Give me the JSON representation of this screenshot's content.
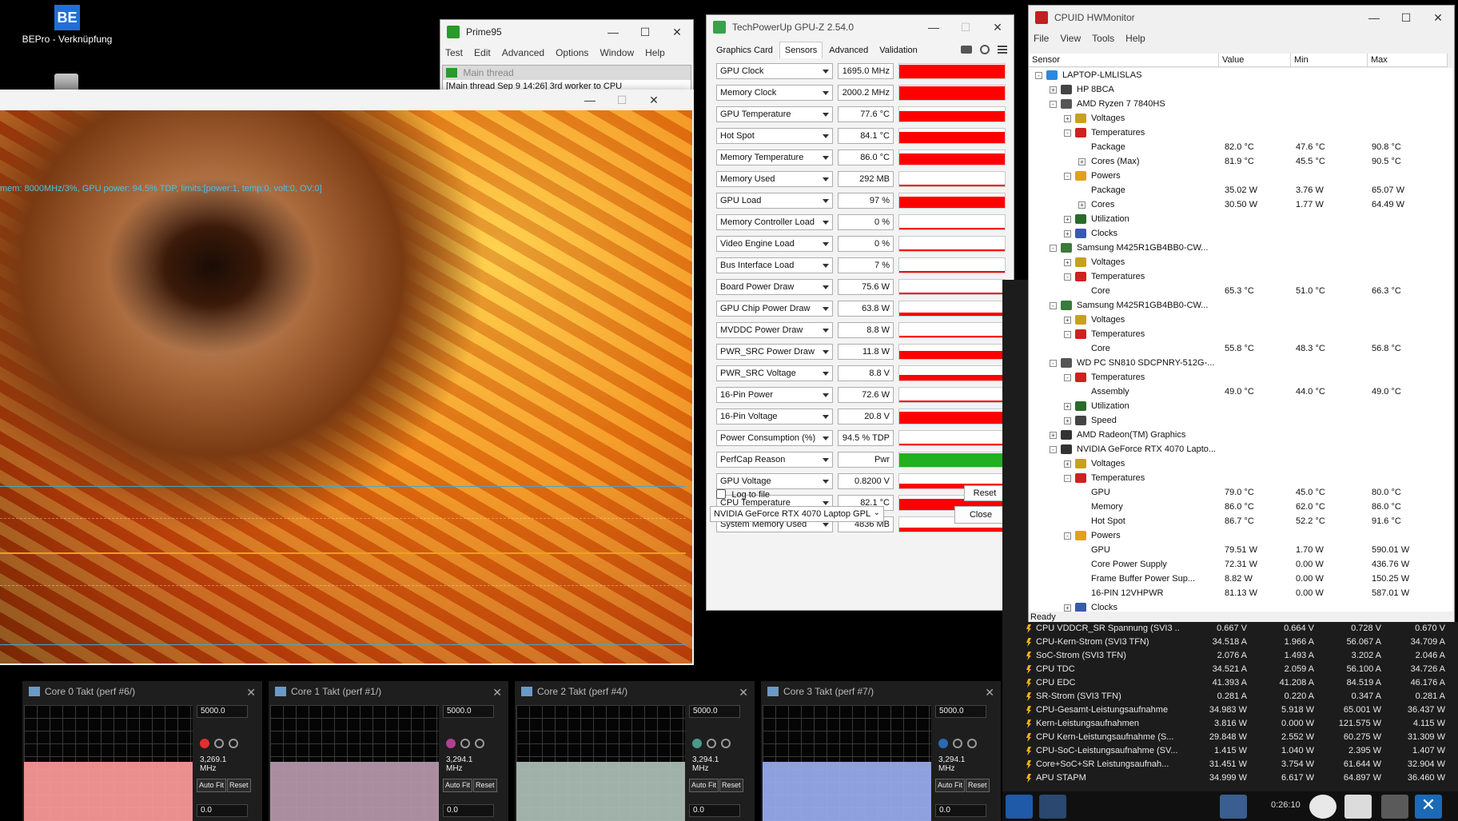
{
  "desktop": {
    "shortcut_label": "BEPro - Verknüpfung",
    "logo_text": "BE"
  },
  "prime95": {
    "title": "Prime95",
    "menu": [
      "Test",
      "Edit",
      "Advanced",
      "Options",
      "Window",
      "Help"
    ],
    "subwindow_title": "Main thread",
    "subwindow_text": "[Main thread Sep 9 14:26] 3rd worker to CPU"
  },
  "furmark": {
    "info_text": "mem: 8000MHz/3%, GPU power: 94.5% TDP, limits:[power:1, temp:0, volt:0, OV:0]"
  },
  "gpuz": {
    "title": "TechPowerUp GPU-Z 2.54.0",
    "tabs": [
      "Graphics Card",
      "Sensors",
      "Advanced",
      "Validation"
    ],
    "active_tab": "Sensors",
    "sensors": [
      {
        "name": "GPU Clock",
        "value": "1695.0 MHz",
        "level": 0.95,
        "color": "#ff0000"
      },
      {
        "name": "Memory Clock",
        "value": "2000.2 MHz",
        "level": 0.95,
        "color": "#ff0000"
      },
      {
        "name": "GPU Temperature",
        "value": "77.6 °C",
        "level": 0.7,
        "color": "#ff0000"
      },
      {
        "name": "Hot Spot",
        "value": "84.1 °C",
        "level": 0.75,
        "color": "#ff0000"
      },
      {
        "name": "Memory Temperature",
        "value": "86.0 °C",
        "level": 0.75,
        "color": "#ff0000"
      },
      {
        "name": "Memory Used",
        "value": "292 MB",
        "level": 0.05,
        "color": "#ff0000"
      },
      {
        "name": "GPU Load",
        "value": "97 %",
        "level": 0.75,
        "color": "#ff0000"
      },
      {
        "name": "Memory Controller Load",
        "value": "0 %",
        "level": 0.0,
        "color": "#ff0000"
      },
      {
        "name": "Video Engine Load",
        "value": "0 %",
        "level": 0.0,
        "color": "#ff0000"
      },
      {
        "name": "Bus Interface Load",
        "value": "7 %",
        "level": 0.07,
        "color": "#ff0000"
      },
      {
        "name": "Board Power Draw",
        "value": "75.6 W",
        "level": 0.1,
        "color": "#ff0000"
      },
      {
        "name": "GPU Chip Power Draw",
        "value": "63.8 W",
        "level": 0.2,
        "color": "#ff0000"
      },
      {
        "name": "MVDDC Power Draw",
        "value": "8.8 W",
        "level": 0.1,
        "color": "#ff0000"
      },
      {
        "name": "PWR_SRC Power Draw",
        "value": "11.8 W",
        "level": 0.55,
        "color": "#ff0000"
      },
      {
        "name": "PWR_SRC Voltage",
        "value": "8.8 V",
        "level": 0.4,
        "color": "#ff0000"
      },
      {
        "name": "16-Pin Power",
        "value": "72.6 W",
        "level": 0.1,
        "color": "#ff0000"
      },
      {
        "name": "16-Pin Voltage",
        "value": "20.8 V",
        "level": 0.85,
        "color": "#ff0000"
      },
      {
        "name": "Power Consumption (%)",
        "value": "94.5 % TDP",
        "level": 0.1,
        "color": "#ff0000"
      },
      {
        "name": "PerfCap Reason",
        "value": "Pwr",
        "level": 0.95,
        "color": "#20b020"
      },
      {
        "name": "GPU Voltage",
        "value": "0.8200 V",
        "level": 0.35,
        "color": "#ff0000"
      },
      {
        "name": "CPU Temperature",
        "value": "82.1 °C",
        "level": 0.75,
        "color": "#ff0000"
      },
      {
        "name": "System Memory Used",
        "value": "4836 MB",
        "level": 0.3,
        "color": "#ff0000"
      }
    ],
    "log_to_file": "Log to file",
    "reset": "Reset",
    "device": "NVIDIA GeForce RTX 4070 Laptop GPL",
    "close": "Close"
  },
  "hwmonitor": {
    "title": "CPUID HWMonitor",
    "menu": [
      "File",
      "View",
      "Tools",
      "Help"
    ],
    "columns": [
      "Sensor",
      "Value",
      "Min",
      "Max"
    ],
    "status": "Ready",
    "rows": [
      {
        "label": "LAPTOP-LMLISLAS",
        "indent": 0,
        "exp": "-",
        "icon": "computer-icon"
      },
      {
        "label": "HP 8BCA",
        "indent": 1,
        "exp": "+",
        "icon": "motherboard-icon"
      },
      {
        "label": "AMD Ryzen 7 7840HS",
        "indent": 1,
        "exp": "-",
        "icon": "cpu-icon"
      },
      {
        "label": "Voltages",
        "indent": 2,
        "exp": "+",
        "icon": "voltage-icon"
      },
      {
        "label": "Temperatures",
        "indent": 2,
        "exp": "-",
        "icon": "thermometer-icon"
      },
      {
        "label": "Package",
        "indent": 3,
        "exp": "",
        "icon": "",
        "v": "82.0 °C",
        "min": "47.6 °C",
        "max": "90.8 °C"
      },
      {
        "label": "Cores (Max)",
        "indent": 3,
        "exp": "+",
        "icon": "",
        "v": "81.9 °C",
        "min": "45.5 °C",
        "max": "90.5 °C"
      },
      {
        "label": "Powers",
        "indent": 2,
        "exp": "-",
        "icon": "power-icon"
      },
      {
        "label": "Package",
        "indent": 3,
        "exp": "",
        "icon": "",
        "v": "35.02 W",
        "min": "3.76 W",
        "max": "65.07 W"
      },
      {
        "label": "Cores",
        "indent": 3,
        "exp": "+",
        "icon": "",
        "v": "30.50 W",
        "min": "1.77 W",
        "max": "64.49 W"
      },
      {
        "label": "Utilization",
        "indent": 2,
        "exp": "+",
        "icon": "utilization-icon"
      },
      {
        "label": "Clocks",
        "indent": 2,
        "exp": "+",
        "icon": "clocks-icon"
      },
      {
        "label": "Samsung M425R1GB4BB0-CW...",
        "indent": 1,
        "exp": "-",
        "icon": "memory-icon"
      },
      {
        "label": "Voltages",
        "indent": 2,
        "exp": "+",
        "icon": "voltage-icon"
      },
      {
        "label": "Temperatures",
        "indent": 2,
        "exp": "-",
        "icon": "thermometer-icon"
      },
      {
        "label": "Core",
        "indent": 3,
        "exp": "",
        "icon": "",
        "v": "65.3 °C",
        "min": "51.0 °C",
        "max": "66.3 °C"
      },
      {
        "label": "Samsung M425R1GB4BB0-CW...",
        "indent": 1,
        "exp": "-",
        "icon": "memory-icon"
      },
      {
        "label": "Voltages",
        "indent": 2,
        "exp": "+",
        "icon": "voltage-icon"
      },
      {
        "label": "Temperatures",
        "indent": 2,
        "exp": "-",
        "icon": "thermometer-icon"
      },
      {
        "label": "Core",
        "indent": 3,
        "exp": "",
        "icon": "",
        "v": "55.8 °C",
        "min": "48.3 °C",
        "max": "56.8 °C"
      },
      {
        "label": "WD PC SN810 SDCPNRY-512G-...",
        "indent": 1,
        "exp": "-",
        "icon": "drive-icon"
      },
      {
        "label": "Temperatures",
        "indent": 2,
        "exp": "-",
        "icon": "thermometer-icon"
      },
      {
        "label": "Assembly",
        "indent": 3,
        "exp": "",
        "icon": "",
        "v": "49.0 °C",
        "min": "44.0 °C",
        "max": "49.0 °C"
      },
      {
        "label": "Utilization",
        "indent": 2,
        "exp": "+",
        "icon": "utilization-icon"
      },
      {
        "label": "Speed",
        "indent": 2,
        "exp": "+",
        "icon": "speed-icon"
      },
      {
        "label": "AMD Radeon(TM) Graphics",
        "indent": 1,
        "exp": "+",
        "icon": "gpu-icon"
      },
      {
        "label": "NVIDIA GeForce RTX 4070 Lapto...",
        "indent": 1,
        "exp": "-",
        "icon": "gpu-icon"
      },
      {
        "label": "Voltages",
        "indent": 2,
        "exp": "+",
        "icon": "voltage-icon"
      },
      {
        "label": "Temperatures",
        "indent": 2,
        "exp": "-",
        "icon": "thermometer-icon"
      },
      {
        "label": "GPU",
        "indent": 3,
        "exp": "",
        "icon": "",
        "v": "79.0 °C",
        "min": "45.0 °C",
        "max": "80.0 °C"
      },
      {
        "label": "Memory",
        "indent": 3,
        "exp": "",
        "icon": "",
        "v": "86.0 °C",
        "min": "62.0 °C",
        "max": "86.0 °C"
      },
      {
        "label": "Hot Spot",
        "indent": 3,
        "exp": "",
        "icon": "",
        "v": "86.7 °C",
        "min": "52.2 °C",
        "max": "91.6 °C"
      },
      {
        "label": "Powers",
        "indent": 2,
        "exp": "-",
        "icon": "power-icon"
      },
      {
        "label": "GPU",
        "indent": 3,
        "exp": "",
        "icon": "",
        "v": "79.51 W",
        "min": "1.70 W",
        "max": "590.01 W"
      },
      {
        "label": "Core Power Supply",
        "indent": 3,
        "exp": "",
        "icon": "",
        "v": "72.31 W",
        "min": "0.00 W",
        "max": "436.76 W"
      },
      {
        "label": "Frame Buffer Power Sup...",
        "indent": 3,
        "exp": "",
        "icon": "",
        "v": "8.82 W",
        "min": "0.00 W",
        "max": "150.25 W"
      },
      {
        "label": "16-PIN 12VHPWR",
        "indent": 3,
        "exp": "",
        "icon": "",
        "v": "81.13 W",
        "min": "0.00 W",
        "max": "587.01 W"
      },
      {
        "label": "Clocks",
        "indent": 2,
        "exp": "+",
        "icon": "clocks-icon"
      }
    ]
  },
  "hwinfo": {
    "rows": [
      {
        "name": "CPU VDDCR_SR Spannung (SVI3 ...",
        "v": "0.667 V",
        "min": "0.664 V",
        "max": "0.728 V",
        "avg": "0.670 V"
      },
      {
        "name": "CPU-Kern-Strom (SVI3 TFN)",
        "v": "34.518 A",
        "min": "1.966 A",
        "max": "56.067 A",
        "avg": "34.709 A"
      },
      {
        "name": "SoC-Strom (SVI3 TFN)",
        "v": "2.076 A",
        "min": "1.493 A",
        "max": "3.202 A",
        "avg": "2.046 A"
      },
      {
        "name": "CPU TDC",
        "v": "34.521 A",
        "min": "2.059 A",
        "max": "56.100 A",
        "avg": "34.726 A"
      },
      {
        "name": "CPU EDC",
        "v": "41.393 A",
        "min": "41.208 A",
        "max": "84.519 A",
        "avg": "46.176 A"
      },
      {
        "name": "SR-Strom (SVI3 TFN)",
        "v": "0.281 A",
        "min": "0.220 A",
        "max": "0.347 A",
        "avg": "0.281 A"
      },
      {
        "name": "CPU-Gesamt-Leistungsaufnahme",
        "v": "34.983 W",
        "min": "5.918 W",
        "max": "65.001 W",
        "avg": "36.437 W"
      },
      {
        "name": "Kern-Leistungsaufnahmen",
        "v": "3.816 W",
        "min": "0.000 W",
        "max": "121.575 W",
        "avg": "4.115 W"
      },
      {
        "name": "CPU Kern-Leistungsaufnahme (S...",
        "v": "29.848 W",
        "min": "2.552 W",
        "max": "60.275 W",
        "avg": "31.309 W"
      },
      {
        "name": "CPU-SoC-Leistungsaufnahme (SV...",
        "v": "1.415 W",
        "min": "1.040 W",
        "max": "2.395 W",
        "avg": "1.407 W"
      },
      {
        "name": "Core+SoC+SR Leistungsaufnah...",
        "v": "31.451 W",
        "min": "3.754 W",
        "max": "61.644 W",
        "avg": "32.904 W"
      },
      {
        "name": "APU STAPM",
        "v": "34.999 W",
        "min": "6.617 W",
        "max": "64.897 W",
        "avg": "36.460 W"
      }
    ],
    "timer": "0:26:10"
  },
  "gadgets": [
    {
      "title": "Core 0 Takt (perf #6/)",
      "max": "5000.0",
      "freq": "3,269.1 MHz",
      "min": "0.0",
      "color": "#ff9a9a",
      "accent": "#e03030",
      "level": 0.51
    },
    {
      "title": "Core 1 Takt (perf #1/)",
      "max": "5000.0",
      "freq": "3,294.1 MHz",
      "min": "0.0",
      "color": "#b89aad",
      "accent": "#b04090",
      "level": 0.51
    },
    {
      "title": "Core 2 Takt (perf #4/)",
      "max": "5000.0",
      "freq": "3,294.1 MHz",
      "min": "0.0",
      "color": "#aec0b8",
      "accent": "#4a9a8a",
      "level": 0.51
    },
    {
      "title": "Core 3 Takt (perf #7/)",
      "max": "5000.0",
      "freq": "3,294.1 MHz",
      "min": "0.0",
      "color": "#9aaef0",
      "accent": "#2a6ab0",
      "level": 0.51
    }
  ],
  "gadget_buttons": {
    "auto_fit": "Auto Fit",
    "reset": "Reset"
  }
}
